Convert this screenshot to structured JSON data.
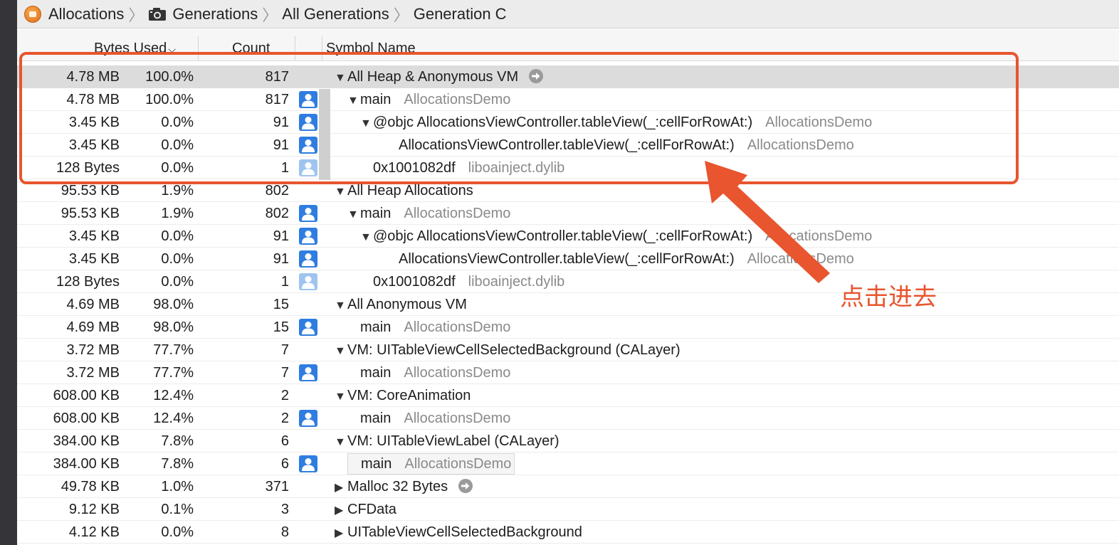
{
  "breadcrumb": {
    "items": [
      "Allocations",
      "Generations",
      "All Generations",
      "Generation C"
    ],
    "icons": [
      "allocations-app-icon",
      "camera-icon"
    ]
  },
  "header": {
    "bytes_used": "Bytes Used",
    "count": "Count",
    "symbol_name": "Symbol Name"
  },
  "rows": [
    {
      "bytes": "4.78 MB",
      "pct": "100.0%",
      "count": "817",
      "icon": "none",
      "expand": "expanded",
      "level": 0,
      "symbol": "All Heap & Anonymous VM",
      "lib": "",
      "goto": true,
      "selected": true
    },
    {
      "bytes": "4.78 MB",
      "pct": "100.0%",
      "count": "817",
      "icon": "user",
      "expand": "expanded",
      "level": 1,
      "symbol": "main",
      "lib": "AllocationsDemo"
    },
    {
      "bytes": "3.45 KB",
      "pct": "0.0%",
      "count": "91",
      "icon": "user",
      "expand": "expanded",
      "level": 2,
      "symbol": "@objc AllocationsViewController.tableView(_:cellForRowAt:)",
      "lib": "AllocationsDemo"
    },
    {
      "bytes": "3.45 KB",
      "pct": "0.0%",
      "count": "91",
      "icon": "user",
      "expand": "none",
      "level": 3,
      "symbol": "AllocationsViewController.tableView(_:cellForRowAt:)",
      "lib": "AllocationsDemo"
    },
    {
      "bytes": "128 Bytes",
      "pct": "0.0%",
      "count": "1",
      "icon": "user-light",
      "expand": "none",
      "level": 2,
      "symbol": "0x1001082df",
      "lib": "liboainject.dylib"
    },
    {
      "bytes": "95.53 KB",
      "pct": "1.9%",
      "count": "802",
      "icon": "none",
      "expand": "expanded",
      "level": 0,
      "symbol": "All Heap Allocations",
      "lib": ""
    },
    {
      "bytes": "95.53 KB",
      "pct": "1.9%",
      "count": "802",
      "icon": "user",
      "expand": "expanded",
      "level": 1,
      "symbol": "main",
      "lib": "AllocationsDemo"
    },
    {
      "bytes": "3.45 KB",
      "pct": "0.0%",
      "count": "91",
      "icon": "user",
      "expand": "expanded",
      "level": 2,
      "symbol": "@objc AllocationsViewController.tableView(_:cellForRowAt:)",
      "lib": "AllocationsDemo"
    },
    {
      "bytes": "3.45 KB",
      "pct": "0.0%",
      "count": "91",
      "icon": "user",
      "expand": "none",
      "level": 3,
      "symbol": "AllocationsViewController.tableView(_:cellForRowAt:)",
      "lib": "AllocationsDemo"
    },
    {
      "bytes": "128 Bytes",
      "pct": "0.0%",
      "count": "1",
      "icon": "user-light",
      "expand": "none",
      "level": 2,
      "symbol": "0x1001082df",
      "lib": "liboainject.dylib"
    },
    {
      "bytes": "4.69 MB",
      "pct": "98.0%",
      "count": "15",
      "icon": "none",
      "expand": "expanded",
      "level": 0,
      "symbol": "All Anonymous VM",
      "lib": ""
    },
    {
      "bytes": "4.69 MB",
      "pct": "98.0%",
      "count": "15",
      "icon": "user",
      "expand": "none",
      "level": 1,
      "symbol": "main",
      "lib": "AllocationsDemo"
    },
    {
      "bytes": "3.72 MB",
      "pct": "77.7%",
      "count": "7",
      "icon": "none",
      "expand": "expanded",
      "level": 0,
      "symbol": "VM: UITableViewCellSelectedBackground (CALayer)",
      "lib": ""
    },
    {
      "bytes": "3.72 MB",
      "pct": "77.7%",
      "count": "7",
      "icon": "user",
      "expand": "none",
      "level": 1,
      "symbol": "main",
      "lib": "AllocationsDemo"
    },
    {
      "bytes": "608.00 KB",
      "pct": "12.4%",
      "count": "2",
      "icon": "none",
      "expand": "expanded",
      "level": 0,
      "symbol": "VM: CoreAnimation",
      "lib": ""
    },
    {
      "bytes": "608.00 KB",
      "pct": "12.4%",
      "count": "2",
      "icon": "user",
      "expand": "none",
      "level": 1,
      "symbol": "main",
      "lib": "AllocationsDemo"
    },
    {
      "bytes": "384.00 KB",
      "pct": "7.8%",
      "count": "6",
      "icon": "none",
      "expand": "expanded",
      "level": 0,
      "symbol": "VM: UITableViewLabel (CALayer)",
      "lib": ""
    },
    {
      "bytes": "384.00 KB",
      "pct": "7.8%",
      "count": "6",
      "icon": "user",
      "expand": "none",
      "level": 1,
      "symbol": "main",
      "lib": "AllocationsDemo",
      "boxed": true
    },
    {
      "bytes": "49.78 KB",
      "pct": "1.0%",
      "count": "371",
      "icon": "none",
      "expand": "collapsed",
      "level": 0,
      "symbol": "Malloc 32 Bytes",
      "lib": "",
      "goto": true
    },
    {
      "bytes": "9.12 KB",
      "pct": "0.1%",
      "count": "3",
      "icon": "none",
      "expand": "collapsed",
      "level": 0,
      "symbol": "CFData",
      "lib": ""
    },
    {
      "bytes": "4.12 KB",
      "pct": "0.0%",
      "count": "8",
      "icon": "none",
      "expand": "collapsed",
      "level": 0,
      "symbol": "UITableViewCellSelectedBackground",
      "lib": ""
    }
  ],
  "annotation": {
    "text": "点击进去",
    "color": "#e8552e"
  },
  "colors": {
    "selected_row": "#dcdcdc",
    "user_icon": "#2f7de1",
    "user_icon_light": "#9fc4f0",
    "library_text": "#8a8a8a"
  }
}
